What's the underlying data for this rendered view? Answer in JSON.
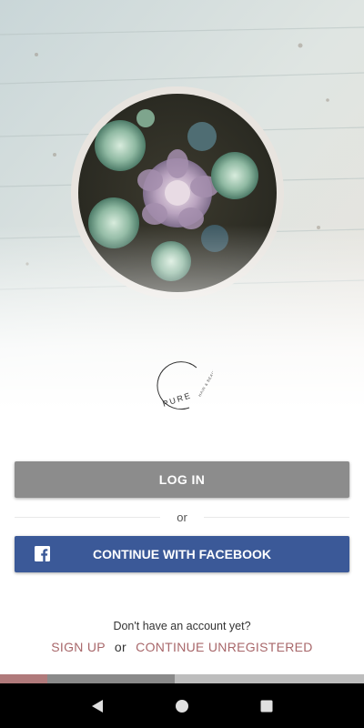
{
  "brand": {
    "logo_text": "PURE",
    "logo_tagline": "HAIR & BEAUTY"
  },
  "hero": {
    "image": "succulent-bowl-on-wood"
  },
  "auth": {
    "login_label": "LOG IN",
    "divider_text": "or",
    "facebook_label": "CONTINUE WITH FACEBOOK",
    "facebook_icon": "facebook-icon"
  },
  "signup": {
    "prompt": "Don't have an account yet?",
    "signup_label": "SIGN UP",
    "separator": "or",
    "unregistered_label": "CONTINUE UNREGISTERED"
  },
  "progress": {
    "segments": [
      {
        "fraction": 0.13,
        "color": "#b07a7b"
      },
      {
        "fraction": 0.35,
        "color": "#8a8a8a"
      },
      {
        "fraction": 0.52,
        "color": "#bdbdbd"
      }
    ]
  },
  "system_nav": {
    "back_icon": "back-triangle-icon",
    "home_icon": "home-circle-icon",
    "recents_icon": "recents-square-icon"
  },
  "colors": {
    "accent": "#a8676a",
    "login_button": "#8c8c8c",
    "facebook": "#3b5998"
  }
}
